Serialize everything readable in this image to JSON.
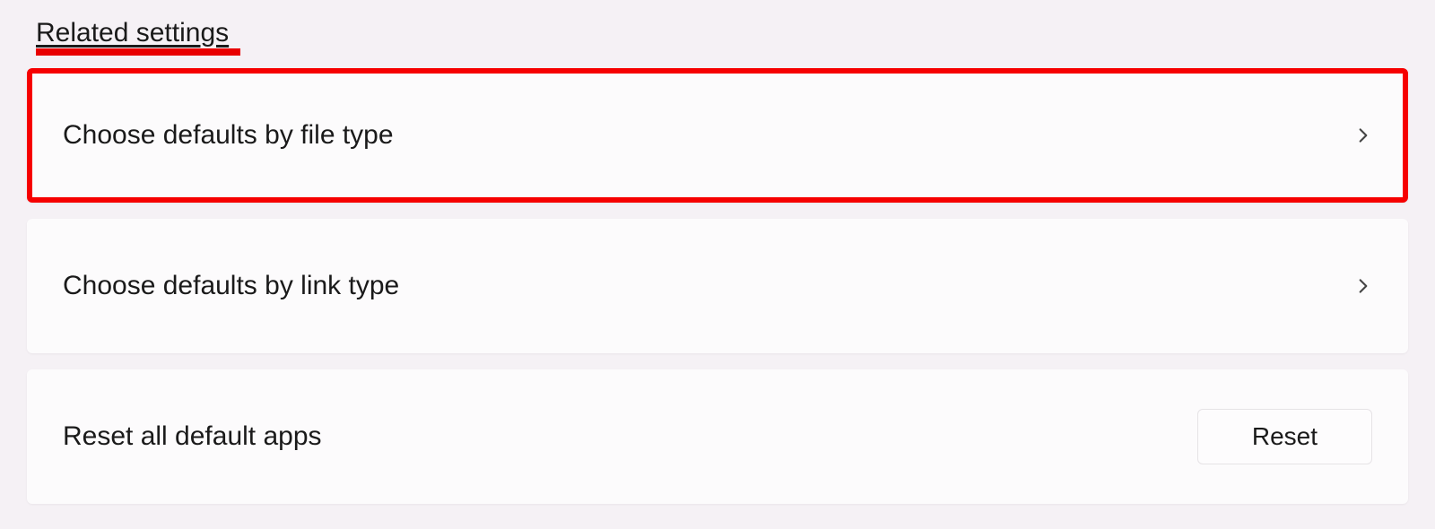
{
  "section": {
    "title": "Related settings"
  },
  "items": [
    {
      "label": "Choose defaults by file type",
      "highlighted": true
    },
    {
      "label": "Choose defaults by link type",
      "highlighted": false
    }
  ],
  "reset": {
    "label": "Reset all default apps",
    "button": "Reset"
  },
  "colors": {
    "highlight": "#f60000",
    "underline": "#e80000",
    "background": "#f5f1f5",
    "card": "#fcfbfc"
  }
}
